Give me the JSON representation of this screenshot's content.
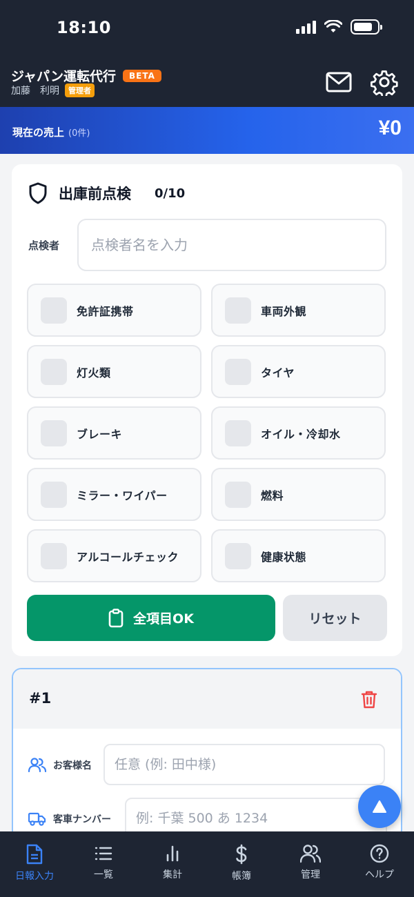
{
  "status_bar": {
    "time": "18:10"
  },
  "header": {
    "app_name": "ジャパン運転代行",
    "beta_badge": "BETA",
    "user_name": "加藤　利明",
    "role_badge": "管理者",
    "mail_icon": "mail-icon",
    "settings_icon": "gear-icon"
  },
  "sales": {
    "label": "現在の売上",
    "count": "(0件)",
    "amount": "¥0"
  },
  "inspection": {
    "title": "出庫前点検",
    "progress": "0/10",
    "inspector_label": "点検者",
    "inspector_placeholder": "点検者名を入力",
    "items": [
      {
        "label": "免許証携帯",
        "checked": false
      },
      {
        "label": "車両外観",
        "checked": false
      },
      {
        "label": "灯火類",
        "checked": false
      },
      {
        "label": "タイヤ",
        "checked": false
      },
      {
        "label": "ブレーキ",
        "checked": false
      },
      {
        "label": "オイル・冷却水",
        "checked": false
      },
      {
        "label": "ミラー・ワイパー",
        "checked": false
      },
      {
        "label": "燃料",
        "checked": false
      },
      {
        "label": "アルコールチェック",
        "checked": false
      },
      {
        "label": "健康状態",
        "checked": false
      }
    ],
    "all_ok_label": "全項目OK",
    "reset_label": "リセット"
  },
  "trip": {
    "number": "#1",
    "customer_label": "お客様名",
    "customer_placeholder": "任意 (例: 田中様)",
    "plate_label": "客車ナンバー",
    "plate_placeholder": "例: 千葉 500 あ 1234"
  },
  "colors": {
    "accent": "#3b82f6",
    "ok_green": "#059669",
    "header_bg": "#1e2533",
    "beta": "#f97316",
    "delete": "#ef4444"
  },
  "nav": [
    {
      "label": "日報入力",
      "icon": "document-icon",
      "active": true
    },
    {
      "label": "一覧",
      "icon": "list-icon",
      "active": false
    },
    {
      "label": "集計",
      "icon": "bar-chart-icon",
      "active": false
    },
    {
      "label": "帳簿",
      "icon": "dollar-icon",
      "active": false
    },
    {
      "label": "管理",
      "icon": "users-icon",
      "active": false
    },
    {
      "label": "ヘルプ",
      "icon": "help-icon",
      "active": false
    }
  ]
}
